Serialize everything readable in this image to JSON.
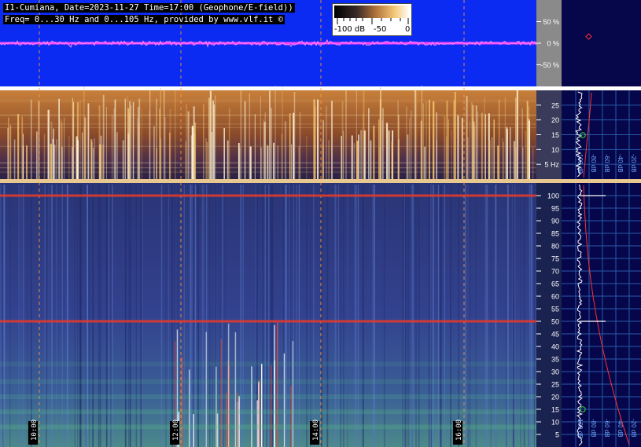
{
  "header": {
    "line1": "I1-Cumiana, Date=2023-11-27 Time=17:00 (Geophone/E-field))",
    "line2": "Freq= 0...30 Hz and 0...105 Hz, provided by www.vlf.it ©"
  },
  "colorbar": {
    "labels": [
      "-100 dB",
      "-50",
      "0"
    ]
  },
  "colors": {
    "signal_bg": "#0b2bf2",
    "signal_line": "#ff44ff",
    "side_bg": "#06064a",
    "lower_bg": "#2a3a8c",
    "guide": "#ff9a3c",
    "hum": "#e23a2a"
  },
  "chart_data": [
    {
      "type": "line",
      "panel": "signal",
      "y_tick_labels": [
        "50 %",
        "0 %",
        "-50 %"
      ],
      "ylim": [
        -100,
        100
      ]
    },
    {
      "type": "heatmap",
      "panel": "spectrogram-0-30Hz",
      "y_tick_labels": [
        "25",
        "20",
        "15",
        "10",
        "5 Hz"
      ],
      "ylim": [
        0,
        30
      ],
      "side_axis_labels": [
        "100 dB",
        "-80 dB",
        "-60 dB",
        "-40 dB",
        "-20 dB"
      ]
    },
    {
      "type": "heatmap",
      "panel": "spectrogram-0-105Hz",
      "y_tick_labels": [
        "100",
        "95",
        "90",
        "85",
        "80",
        "75",
        "70",
        "65",
        "60",
        "55",
        "50",
        "45",
        "40",
        "35",
        "30",
        "25",
        "20",
        "15",
        "10",
        "5"
      ],
      "ylim": [
        0,
        105
      ],
      "x_tick_labels": [
        "10:00",
        "12:00",
        "14:00",
        "16:00"
      ],
      "side_axis_labels": [
        "100 dB",
        "-80 dB",
        "-60 dB",
        "-40 dB",
        "-20 dB"
      ],
      "hum_lines_hz": [
        50,
        100
      ]
    }
  ]
}
